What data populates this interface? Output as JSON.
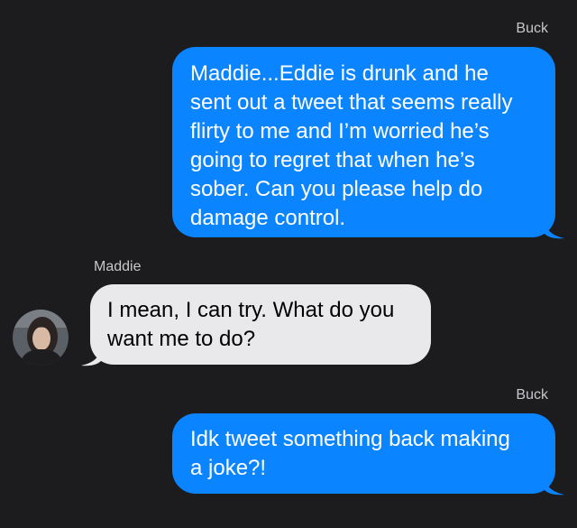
{
  "messages": [
    {
      "sender": "Buck",
      "direction": "outgoing",
      "text": "Maddie...Eddie is drunk and he\nsent out a tweet that seems really\nflirty to me and I’m worried he’s\ngoing to regret that when he’s\nsober. Can you please help do\ndamage control."
    },
    {
      "sender": "Maddie",
      "direction": "incoming",
      "text": "I mean, I can try. What do you\nwant me to do?"
    },
    {
      "sender": "Buck",
      "direction": "outgoing",
      "text": "Idk tweet something back making\na joke?!"
    }
  ],
  "colors": {
    "background": "#1c1c1e",
    "outgoing_bubble": "#0b84ff",
    "incoming_bubble": "#e9e9eb",
    "sender_label": "#c7c7cc"
  }
}
